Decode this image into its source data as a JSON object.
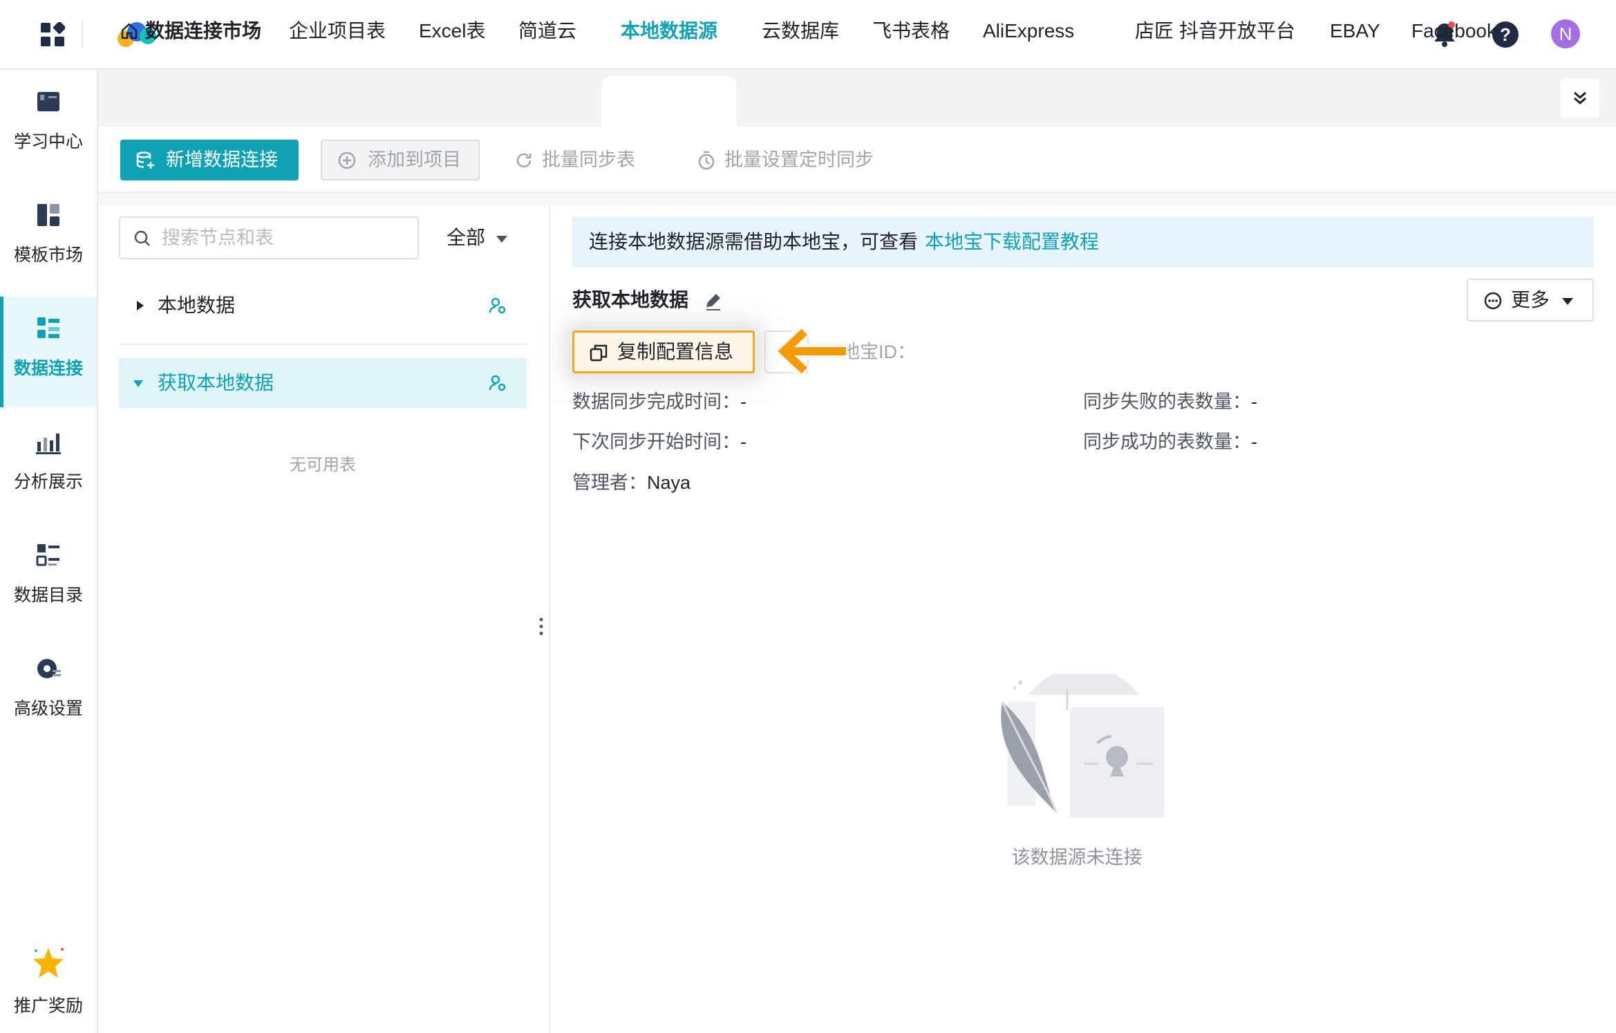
{
  "header": {
    "avatar_initial": "N",
    "colors": {
      "brand": "#0fa1b4",
      "avatar": "#a56de2",
      "highlight": "#f5a524"
    }
  },
  "sidebar": {
    "items": [
      {
        "label": "学习中心",
        "icon": "book-icon"
      },
      {
        "label": "模板市场",
        "icon": "template-icon"
      },
      {
        "label": "数据连接",
        "icon": "data-connect-icon",
        "active": true
      },
      {
        "label": "分析展示",
        "icon": "chart-icon"
      },
      {
        "label": "数据目录",
        "icon": "catalog-icon"
      },
      {
        "label": "高级设置",
        "icon": "settings-icon"
      }
    ],
    "promo": {
      "label": "推广奖励",
      "icon": "star-icon"
    }
  },
  "tabs": {
    "home": "数据连接市场",
    "items": [
      "企业项目表",
      "Excel表",
      "简道云",
      "本地数据源",
      "云数据库",
      "飞书表格",
      "AliExpress",
      "店匠",
      "抖音开放平台",
      "EBAY",
      "Facebook"
    ],
    "active": "本地数据源"
  },
  "toolbar": {
    "add_connection": "新增数据连接",
    "add_to_project": "添加到项目",
    "batch_sync": "批量同步表",
    "batch_schedule": "批量设置定时同步"
  },
  "left": {
    "search_placeholder": "搜索节点和表",
    "filter": "全部",
    "tree": [
      {
        "label": "本地数据",
        "expanded": false,
        "selected": false
      },
      {
        "label": "获取本地数据",
        "expanded": true,
        "selected": true
      }
    ],
    "empty": "无可用表"
  },
  "right": {
    "notice_text": "连接本地数据源需借助本地宝，可查看",
    "notice_link": "本地宝下载配置教程",
    "title": "获取本地数据",
    "more": "更多",
    "copy_button": "复制配置信息",
    "id_label": "本地宝ID：",
    "fields": {
      "sync_done_label": "数据同步完成时间：",
      "sync_done_value": "-",
      "next_sync_label": "下次同步开始时间：",
      "next_sync_value": "-",
      "admin_label": "管理者：",
      "admin_value": "Naya",
      "fail_label": "同步失败的表数量：",
      "fail_value": "-",
      "success_label": "同步成功的表数量：",
      "success_value": "-"
    },
    "empty_text": "该数据源未连接"
  }
}
